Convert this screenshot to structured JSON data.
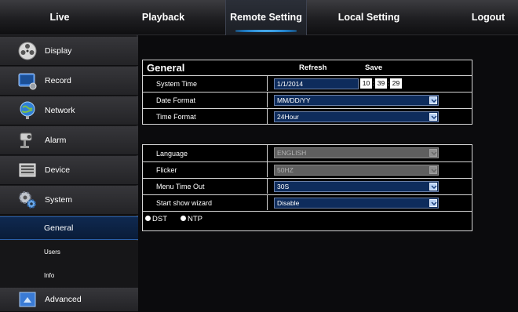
{
  "topnav": {
    "tabs": [
      {
        "label": "Live"
      },
      {
        "label": "Playback"
      },
      {
        "label": "Remote Setting"
      },
      {
        "label": "Local Setting"
      },
      {
        "label": "Logout"
      }
    ],
    "active": "Remote Setting"
  },
  "sidebar": {
    "items": [
      {
        "label": "Display",
        "icon": "display-icon"
      },
      {
        "label": "Record",
        "icon": "record-icon"
      },
      {
        "label": "Network",
        "icon": "network-icon"
      },
      {
        "label": "Alarm",
        "icon": "alarm-icon"
      },
      {
        "label": "Device",
        "icon": "device-icon"
      },
      {
        "label": "System",
        "icon": "system-icon"
      }
    ],
    "system_sub": [
      {
        "label": "General",
        "active": true
      },
      {
        "label": "Users"
      },
      {
        "label": "Info"
      }
    ],
    "advanced": {
      "label": "Advanced",
      "icon": "advanced-icon"
    }
  },
  "general": {
    "title": "General",
    "refresh_label": "Refresh",
    "save_label": "Save",
    "system_time": {
      "label": "System Time",
      "date": "1/1/2014",
      "hour": "10",
      "minute": "39",
      "second": "29"
    },
    "date_format": {
      "label": "Date Format",
      "value": "MM/DD/YY"
    },
    "time_format": {
      "label": "Time Format",
      "value": "24Hour"
    },
    "language": {
      "label": "Language",
      "value": "ENGLISH",
      "disabled": true
    },
    "flicker": {
      "label": "Flicker",
      "value": "50HZ",
      "disabled": true
    },
    "menu_timeout": {
      "label": "Menu Time Out",
      "value": "30S"
    },
    "start_wizard": {
      "label": "Start show wizard",
      "value": "Disable"
    },
    "dst_label": "DST",
    "ntp_label": "NTP"
  },
  "colors": {
    "accent": "#1d8be0",
    "select_bg": "#0e2c5c",
    "active_sub": "#0f2950"
  }
}
